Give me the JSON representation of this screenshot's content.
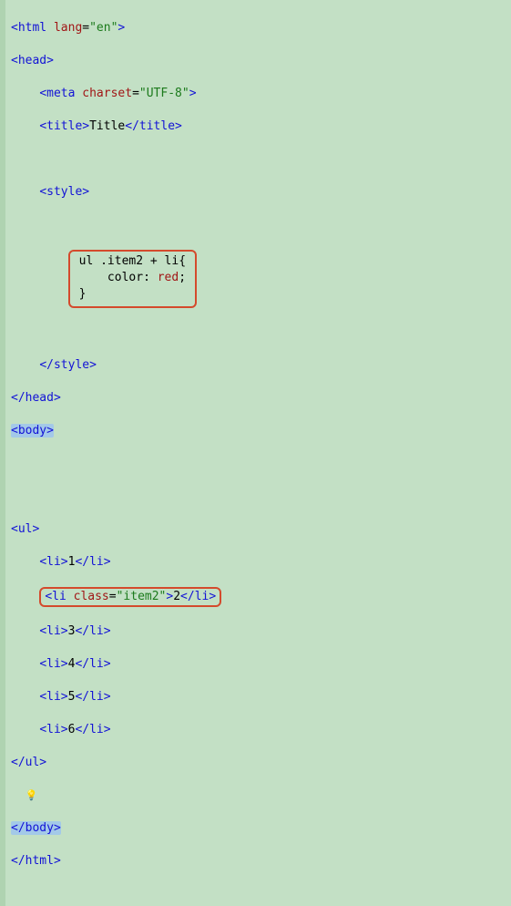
{
  "line1": {
    "tagOpen": "<html ",
    "attr": "lang",
    "eq": "=",
    "val": "\"en\"",
    "tagClose": ">"
  },
  "line2": {
    "tagOpen": "<head>"
  },
  "line3": {
    "indent": "    ",
    "tagOpen": "<meta ",
    "attr": "charset",
    "eq": "=",
    "val": "\"UTF-8\"",
    "tagClose": ">"
  },
  "line4": {
    "indent": "    ",
    "tagOpen": "<title>",
    "text": "Title",
    "tagClose": "</title>"
  },
  "line6": {
    "indent": "    ",
    "tagOpen": "<style>"
  },
  "css": {
    "selector": "ul .item2 + li{",
    "rule": "    color: ",
    "value": "red",
    "semi": ";",
    "close": "}"
  },
  "line12": {
    "indent": "    ",
    "tagClose": "</style>"
  },
  "line13": {
    "tagClose": "</head>"
  },
  "line14": {
    "tagOpen": "<body>"
  },
  "line17": {
    "tagOpen": "<ul>"
  },
  "li1": {
    "indent": "    ",
    "open": "<li>",
    "num": "1",
    "close": "</li>"
  },
  "li2": {
    "indent": "    ",
    "open": "<li ",
    "attr": "class",
    "eq": "=",
    "val": "\"item2\"",
    "gt": ">",
    "num": "2",
    "close": "</li>"
  },
  "li3": {
    "indent": "    ",
    "open": "<li>",
    "num": "3",
    "close": "</li>"
  },
  "li4": {
    "indent": "    ",
    "open": "<li>",
    "num": "4",
    "close": "</li>"
  },
  "li5": {
    "indent": "    ",
    "open": "<li>",
    "num": "5",
    "close": "</li>"
  },
  "li6": {
    "indent": "    ",
    "open": "<li>",
    "num": "6",
    "close": "</li>"
  },
  "line24": {
    "tagClose": "</ul>"
  },
  "bulb": "💡",
  "line26": {
    "tagClose": "</body>"
  },
  "line27": {
    "tagClose": "</html>"
  }
}
